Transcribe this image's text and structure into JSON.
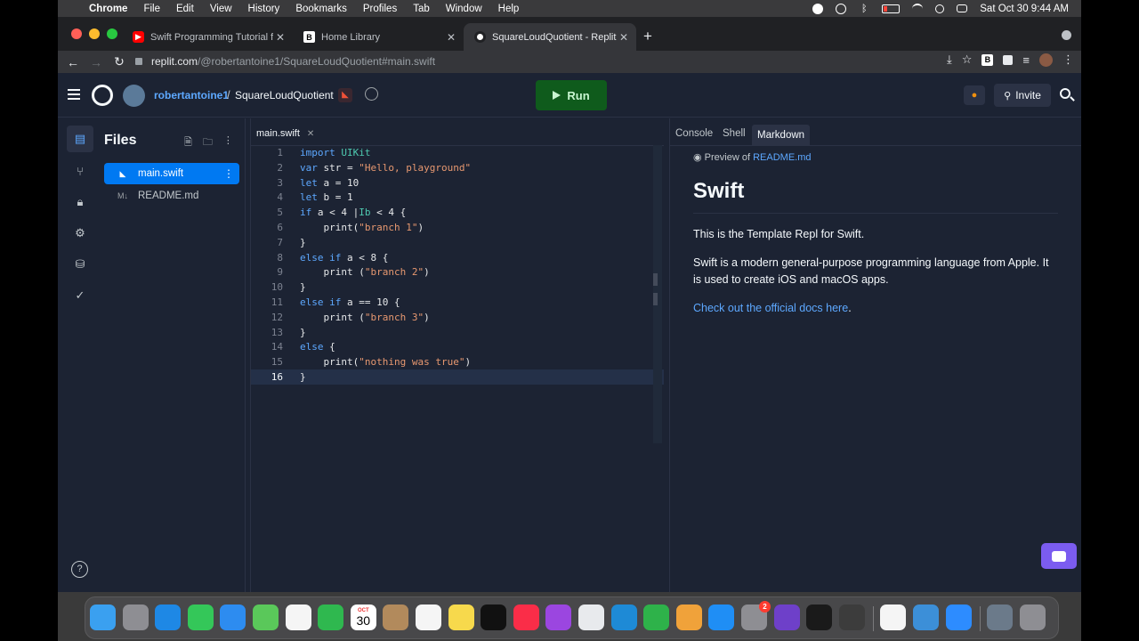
{
  "menubar": {
    "app": "Chrome",
    "items": [
      "File",
      "Edit",
      "View",
      "History",
      "Bookmarks",
      "Profiles",
      "Tab",
      "Window",
      "Help"
    ],
    "datetime": "Sat Oct 30  9:44 AM"
  },
  "tabs": [
    {
      "title": "Swift Programming Tutorial for",
      "favicon": "youtube-icon",
      "active": false
    },
    {
      "title": "Home Library",
      "favicon": "b-icon",
      "active": false
    },
    {
      "title": "SquareLoudQuotient - Replit",
      "favicon": "replit-icon",
      "active": true
    }
  ],
  "url": {
    "host": "replit.com",
    "path": "/@robertantoine1/SquareLoudQuotient#main.swift"
  },
  "replit": {
    "user": "robertantoine1",
    "separator": "/",
    "repl_name": "SquareLoudQuotient",
    "run_label": "Run",
    "invite_label": "Invite"
  },
  "files": {
    "title": "Files",
    "items": [
      {
        "name": "main.swift",
        "selected": true
      },
      {
        "name": "README.md",
        "selected": false
      }
    ]
  },
  "editor": {
    "tab": "main.swift",
    "current_line": 16,
    "lines": [
      {
        "n": "1",
        "html": "<span class='kw'>import</span> <span class='ty'>UIKit</span>"
      },
      {
        "n": "2",
        "html": "<span class='kw'>var</span> str = <span class='str'>\"Hello, playground\"</span>"
      },
      {
        "n": "3",
        "html": "<span class='kw'>let</span> a = 10"
      },
      {
        "n": "4",
        "html": "<span class='kw'>let</span> b = 1"
      },
      {
        "n": "5",
        "html": "<span class='kw'>if</span> a &lt; 4 |<span class='ty'>Ib</span> &lt; 4 {"
      },
      {
        "n": "6",
        "html": "    print(<span class='str'>\"branch 1\"</span>)"
      },
      {
        "n": "7",
        "html": "}"
      },
      {
        "n": "8",
        "html": "<span class='kw'>else</span> <span class='kw'>if</span> a &lt; 8 {"
      },
      {
        "n": "9",
        "html": "    print (<span class='str'>\"branch 2\"</span>)"
      },
      {
        "n": "10",
        "html": "}"
      },
      {
        "n": "11",
        "html": "<span class='kw'>else</span> <span class='kw'>if</span> a == 10 {"
      },
      {
        "n": "12",
        "html": "    print (<span class='str'>\"branch 3\"</span>)"
      },
      {
        "n": "13",
        "html": "}"
      },
      {
        "n": "14",
        "html": "<span class='kw'>else</span> {"
      },
      {
        "n": "15",
        "html": "    print(<span class='str'>\"nothing was true\"</span>)"
      },
      {
        "n": "16",
        "html": "}"
      }
    ]
  },
  "right_tabs": [
    "Console",
    "Shell",
    "Markdown"
  ],
  "markdown": {
    "preview_prefix": "Preview of",
    "preview_file": "README.md",
    "heading": "Swift",
    "p1": "This is the Template Repl for Swift.",
    "p2": "Swift is a modern general-purpose programming language from Apple. It is used to create iOS and macOS apps.",
    "link": "Check out the official docs here",
    "link_suffix": "."
  },
  "dock": {
    "calendar_month": "OCT",
    "calendar_day": "30",
    "notification_badge": "2",
    "apps": [
      "finder-icon",
      "launchpad-icon",
      "safari-icon",
      "messages-icon",
      "mail-icon",
      "maps-icon",
      "photos-icon",
      "facetime-icon",
      "calendar-icon",
      "contacts-icon",
      "reminders-icon",
      "notes-icon",
      "tv-icon",
      "music-icon",
      "podcasts-icon",
      "chrome-icon",
      "keynote-icon",
      "numbers-icon",
      "pages-icon",
      "app-store-icon",
      "system-preferences-icon",
      "github-icon",
      "terminal-icon",
      "sublime-icon",
      "news-icon",
      "quicktime-icon",
      "zoom-icon",
      "preview-icon",
      "trash-icon"
    ]
  },
  "colors": {
    "accent": "#0079f2",
    "run": "#0f5b1c",
    "link": "#5da8ff",
    "bg": "#1c2333"
  }
}
